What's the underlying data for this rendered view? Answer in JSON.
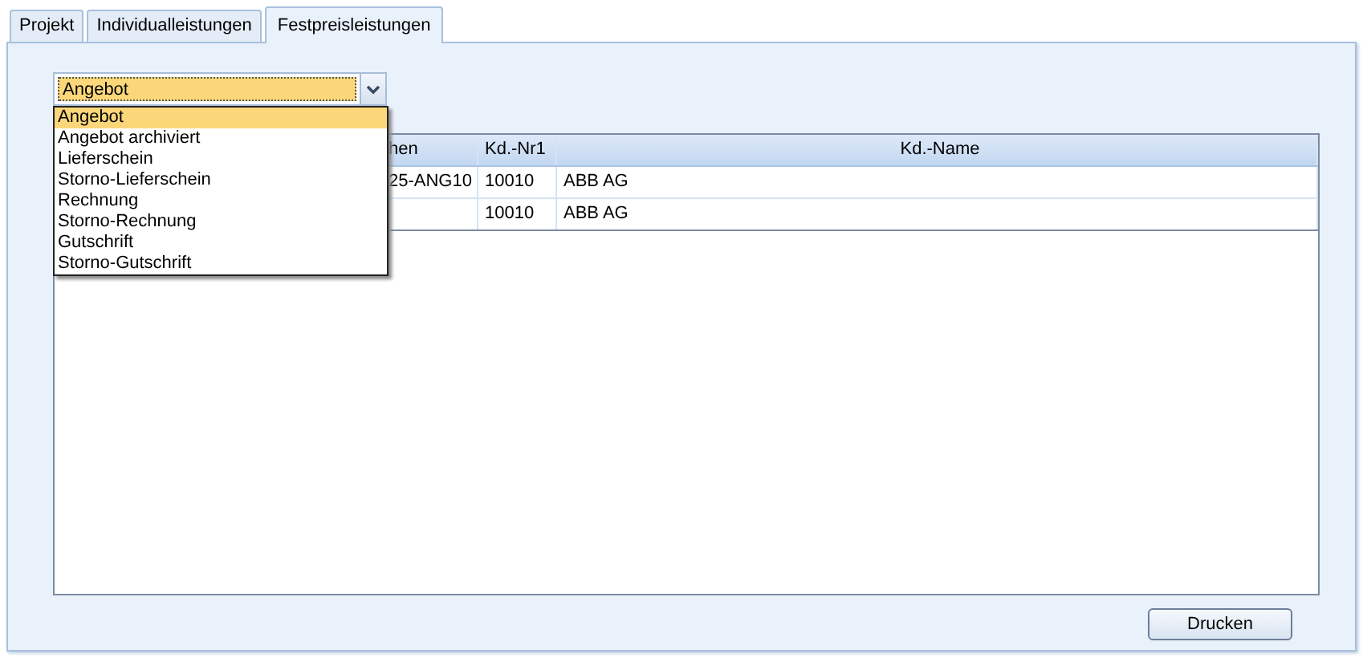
{
  "tabs": [
    {
      "label": "Projekt",
      "selected": false
    },
    {
      "label": "Individualleistungen",
      "selected": false
    },
    {
      "label": "Festpreisleistungen",
      "selected": true
    }
  ],
  "combo": {
    "value": "Angebot",
    "expanded": true,
    "options": [
      {
        "label": "Angebot",
        "selected": true
      },
      {
        "label": "Angebot archiviert",
        "selected": false
      },
      {
        "label": "Lieferschein",
        "selected": false
      },
      {
        "label": "Storno-Lieferschein",
        "selected": false
      },
      {
        "label": "Rechnung",
        "selected": false
      },
      {
        "label": "Storno-Rechnung",
        "selected": false
      },
      {
        "label": "Gutschrift",
        "selected": false
      },
      {
        "label": "Storno-Gutschrift",
        "selected": false
      }
    ]
  },
  "table": {
    "columns": [
      "hen",
      "Kd.-Nr1",
      "Kd.-Name"
    ],
    "rows": [
      [
        "25-ANG10",
        "10010",
        "ABB AG"
      ],
      [
        "",
        "10010",
        "ABB AG"
      ]
    ]
  },
  "buttons": [
    "Drucken"
  ]
}
